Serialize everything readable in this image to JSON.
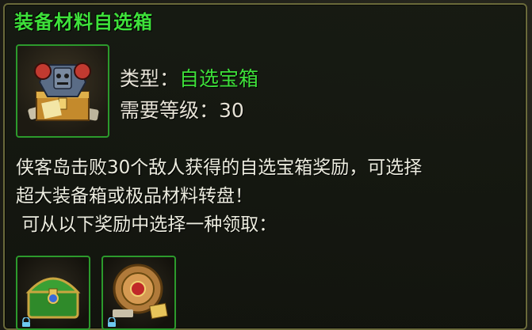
{
  "tooltip": {
    "title": "装备材料自选箱",
    "type_label": "类型：",
    "type_value": "自选宝箱",
    "level_label": "需要等级：",
    "level_value": "30",
    "description": [
      "侠客岛击败30个敌人获得的自选宝箱奖励，可选择",
      "超大装备箱或极品材料转盘！",
      " 可从以下奖励中选择一种领取："
    ]
  },
  "colors": {
    "title_green": "#3ee03a",
    "border_green": "#2c9a2c",
    "text": "#ececdf"
  },
  "rewards": [
    {
      "icon": "green-treasure-chest-icon",
      "locked": true
    },
    {
      "icon": "bronze-wheel-turntable-icon",
      "locked": true
    }
  ]
}
